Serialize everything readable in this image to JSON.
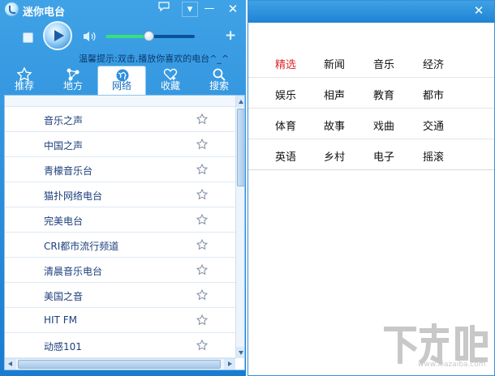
{
  "app": {
    "title": "迷你电台",
    "controls": {
      "menu": "▾",
      "minimize": "—",
      "close": "✕",
      "add": "+"
    },
    "volume_level": 0.48,
    "tip": "温馨提示:双击,播放你喜欢的电台^_^"
  },
  "tabs": [
    {
      "label": "推荐",
      "icon": "star-icon",
      "active": false
    },
    {
      "label": "地方",
      "icon": "location-network-icon",
      "active": false
    },
    {
      "label": "网络",
      "icon": "globe-icon",
      "active": true
    },
    {
      "label": "收藏",
      "icon": "heart-add-icon",
      "active": false
    },
    {
      "label": "搜索",
      "icon": "search-icon",
      "active": false
    }
  ],
  "stations": [
    "音乐之声",
    "中国之声",
    "青檬音乐台",
    "猫扑网络电台",
    "完美电台",
    "CRI都市流行频道",
    "清晨音乐电台",
    "美国之音",
    "HIT FM",
    "动感101"
  ],
  "category_panel": {
    "close": "✕",
    "rows": [
      [
        "精选",
        "新闻",
        "音乐",
        "经济"
      ],
      [
        "娱乐",
        "相声",
        "教育",
        "都市"
      ],
      [
        "体育",
        "故事",
        "戏曲",
        "交通"
      ],
      [
        "英语",
        "乡村",
        "电子",
        "摇滚"
      ]
    ],
    "selected": "精选",
    "selected_color": "#e0282b"
  },
  "colors": {
    "accent": "#1f83d3",
    "station_text": "#1d3f7c"
  },
  "watermark": {
    "logo_text": "下载吧",
    "url": "www.xiazaiba.com"
  }
}
